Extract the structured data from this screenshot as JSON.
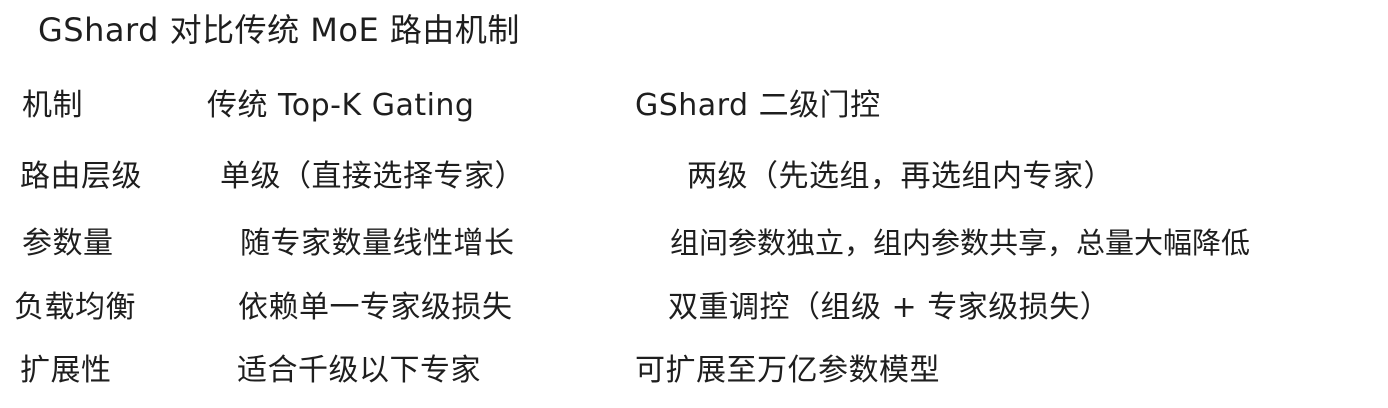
{
  "title": "GShard 对比传统 MoE 路由机制",
  "headers": [
    "机制",
    "传统 Top-K Gating",
    "GShard 二级门控"
  ],
  "rows": [
    [
      "路由层级",
      "单级（直接选择专家）",
      "两级（先选组，再选组内专家）"
    ],
    [
      "参数量",
      "随专家数量线性增长",
      "组间参数独立，组内参数共享，总量大幅降低"
    ],
    [
      "负载均衡",
      "依赖单一专家级损失",
      "双重调控（组级 + 专家级损失）"
    ],
    [
      "扩展性",
      "适合千级以下专家",
      "可扩展至万亿参数模型"
    ]
  ]
}
